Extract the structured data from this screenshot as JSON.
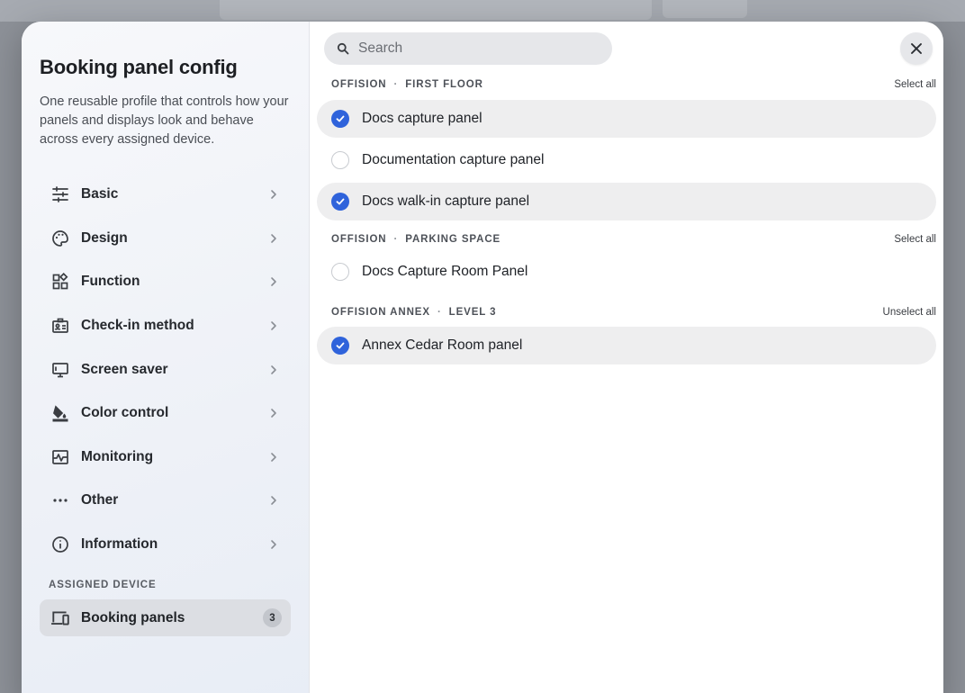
{
  "sidebar": {
    "title": "Booking panel config",
    "description": "One reusable profile that controls how your panels and displays look and behave across every assigned device.",
    "items": [
      {
        "label": "Basic",
        "icon": "sliders-icon"
      },
      {
        "label": "Design",
        "icon": "palette-icon"
      },
      {
        "label": "Function",
        "icon": "widgets-icon"
      },
      {
        "label": "Check-in method",
        "icon": "badge-icon"
      },
      {
        "label": "Screen saver",
        "icon": "monitor-icon"
      },
      {
        "label": "Color control",
        "icon": "paint-bucket-icon"
      },
      {
        "label": "Monitoring",
        "icon": "monitoring-icon"
      },
      {
        "label": "Other",
        "icon": "more-horizontal-icon"
      },
      {
        "label": "Information",
        "icon": "info-icon"
      }
    ],
    "assigned_section_label": "ASSIGNED DEVICE",
    "assigned": {
      "label": "Booking panels",
      "count": "3",
      "icon": "devices-icon"
    }
  },
  "search": {
    "placeholder": "Search",
    "value": ""
  },
  "groups": [
    {
      "location": "OFFISION",
      "area": "FIRST FLOOR",
      "action": "Select all",
      "devices": [
        {
          "label": "Docs capture panel",
          "selected": true
        },
        {
          "label": "Documentation capture panel",
          "selected": false
        },
        {
          "label": "Docs walk-in capture panel",
          "selected": true
        }
      ]
    },
    {
      "location": "OFFISION",
      "area": "PARKING SPACE",
      "action": "Select all",
      "devices": [
        {
          "label": "Docs Capture Room Panel",
          "selected": false
        }
      ]
    },
    {
      "location": "OFFISION ANNEX",
      "area": "LEVEL 3",
      "action": "Unselect all",
      "devices": [
        {
          "label": "Annex Cedar Room panel",
          "selected": true
        }
      ]
    }
  ],
  "colors": {
    "accent": "#2f63db",
    "selected_row": "#eeeeef",
    "sidebar_bg": "#eef1f7"
  }
}
